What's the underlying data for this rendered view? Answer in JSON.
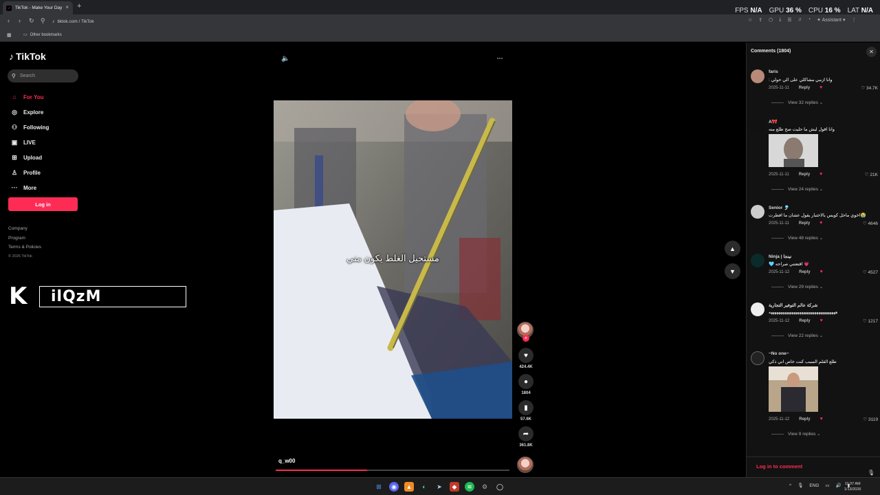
{
  "browser": {
    "tab_title": "TikTok - Make Your Day",
    "url": "tiktok.com / TikTok",
    "bookmark_folder": "Other bookmarks",
    "assistant_label": "Assistant"
  },
  "overlay": {
    "fps_label": "FPS",
    "fps_value": "N/A",
    "gpu_label": "GPU",
    "gpu_value": "36 %",
    "cpu_label": "CPU",
    "cpu_value": "16 %",
    "lat_label": "LAT",
    "lat_value": "N/A"
  },
  "sidebar": {
    "brand": "TikTok",
    "search_placeholder": "Search",
    "menu": [
      {
        "label": "For You",
        "icon": "home-icon"
      },
      {
        "label": "Explore",
        "icon": "compass-icon"
      },
      {
        "label": "Following",
        "icon": "following-icon"
      },
      {
        "label": "LIVE",
        "icon": "live-icon"
      },
      {
        "label": "Upload",
        "icon": "upload-icon"
      },
      {
        "label": "Profile",
        "icon": "profile-icon"
      },
      {
        "label": "More",
        "icon": "more-icon"
      }
    ],
    "login_label": "Log in",
    "footer": {
      "company": "Company",
      "program": "Program",
      "terms": "Terms & Policies",
      "copyright": "© 2026 TikTok"
    }
  },
  "watermark": {
    "text": "ilQzM"
  },
  "video": {
    "caption": "مستحيل الغلط يكون مني",
    "author": "q_w00",
    "progress_percent": 39,
    "likes": "424.4K",
    "comments": "1804",
    "saves": "57.6K",
    "shares": "361.8K"
  },
  "comments": {
    "title": "Comments (1804)",
    "footer_login": "Log in to comment",
    "reply_label": "Reply",
    "items": [
      {
        "name": "faris",
        "text": "وانا ازمي مشاكلي على الي حولي :",
        "date": "2025-11-11",
        "likes": "34.7K",
        "replies": "View 32 replies"
      },
      {
        "name": "A🎀",
        "text": "وانا اقول ليش ما حليت صح طلع منه",
        "date": "2025-11-11",
        "likes": "21K",
        "replies": "View 24 replies"
      },
      {
        "name": "Senior 🎐",
        "text": "😭اخوي ماحل كويس بالاختبار يقول عشان ما افطرت",
        "date": "2025-11-11",
        "likes": "4646",
        "replies": "View 48 replies"
      },
      {
        "name": "Ninja | نينجا",
        "text": "💗 اقنعتني صراحه 🩵",
        "date": "2025-11-12",
        "likes": "4527",
        "replies": "View 29 replies"
      },
      {
        "name": "شركة عالم التوفير التجارية",
        "text": "هههههههههههههههههههههههههههههههههههه",
        "date": "2025-11-12",
        "likes": "1217",
        "replies": "View 22 replies"
      },
      {
        "name": "~No one~",
        "text": "طلع القلم السبب كنت خاص اني ذكي",
        "date": "2025-11-12",
        "likes": "3119",
        "replies": "View 9 replies"
      }
    ]
  },
  "taskbar": {
    "lang": "ENG",
    "time": "11:37 AM",
    "date": "1/13/2026"
  }
}
